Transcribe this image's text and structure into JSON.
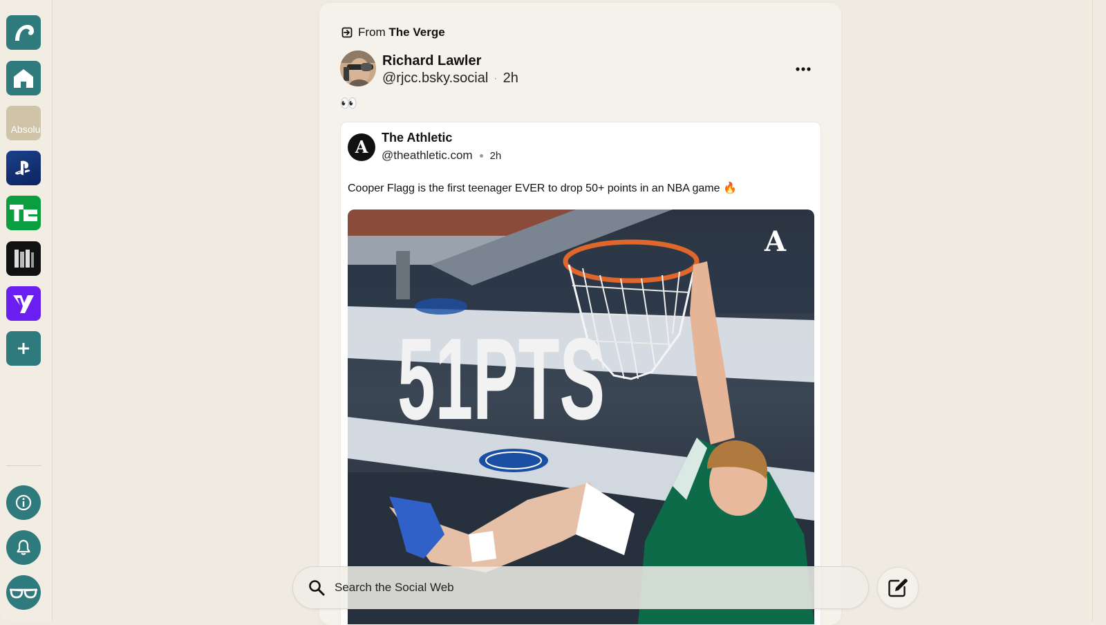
{
  "sidebar": {
    "apps": [
      {
        "name": "surf",
        "icon": "wave-icon"
      },
      {
        "name": "home",
        "icon": "home-icon"
      },
      {
        "name": "absolu",
        "label": "Absolu"
      },
      {
        "name": "playstation",
        "icon": "playstation-icon"
      },
      {
        "name": "techcrunch",
        "label": "TC"
      },
      {
        "name": "w-app",
        "icon": "w-logo-icon"
      },
      {
        "name": "yahoo",
        "label": "Y"
      },
      {
        "name": "add",
        "icon": "plus-icon"
      }
    ],
    "bottom_buttons": [
      "info-icon",
      "bell-icon",
      "glasses-icon"
    ]
  },
  "post": {
    "repost_prefix": "From",
    "repost_source": "The Verge",
    "author_name": "Richard Lawler",
    "author_handle": "@rjcc.bsky.social",
    "time": "2h",
    "separator": "·",
    "body": "👀",
    "quote": {
      "author_name": "The Athletic",
      "avatar_letter": "A",
      "author_handle": "@theathletic.com",
      "time": "2h",
      "text": "Cooper Flagg is the first teenager EVER to drop 50+ points in an NBA game 🔥",
      "image_overlay_text": "51PTS",
      "image_watermark": "A"
    }
  },
  "search": {
    "placeholder": "Search the Social Web"
  },
  "colors": {
    "accent": "#2f7a7c",
    "background": "#efebe1",
    "card": "#f5f2ec"
  }
}
